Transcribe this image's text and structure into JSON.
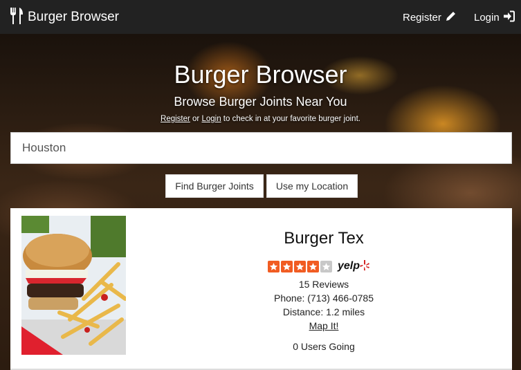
{
  "header": {
    "brand": "Burger Browser",
    "register_label": "Register",
    "login_label": "Login"
  },
  "hero": {
    "title": "Burger Browser",
    "subtitle": "Browse Burger Joints Near You",
    "note_register": "Register",
    "note_or": " or ",
    "note_login": "Login",
    "note_rest": " to check in at your favorite burger joint."
  },
  "search": {
    "value": "Houston",
    "find_button": "Find Burger Joints",
    "location_button": "Use my Location"
  },
  "results": [
    {
      "name": "Burger Tex",
      "rating": 4,
      "rating_max": 5,
      "rating_source": "yelp",
      "reviews": "15 Reviews",
      "phone": "Phone: (713) 466-0785",
      "distance": "Distance: 1.2 miles",
      "map_link": "Map It!",
      "going": "0 Users Going"
    }
  ],
  "colors": {
    "navbar": "#222222",
    "star_filled": "#f15c22",
    "star_empty": "#c8c8c8",
    "yelp_red": "#d32323"
  },
  "icons": {
    "brand": "fork-knife-icon",
    "register": "pencil-icon",
    "login": "sign-in-icon",
    "yelp": "yelp-burst-icon"
  }
}
